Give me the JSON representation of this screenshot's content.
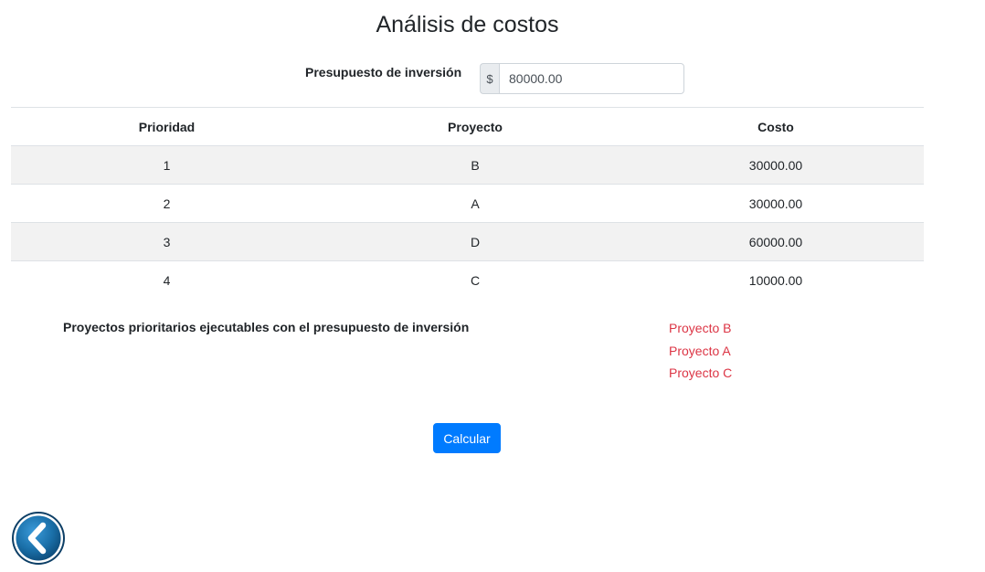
{
  "title": "Análisis de costos",
  "budget": {
    "label": "Presupuesto de inversión",
    "prefix": "$",
    "value": "80000.00"
  },
  "table": {
    "headers": {
      "priority": "Prioridad",
      "project": "Proyecto",
      "cost": "Costo"
    },
    "rows": [
      {
        "priority": "1",
        "project": "B",
        "cost": "30000.00"
      },
      {
        "priority": "2",
        "project": "A",
        "cost": "30000.00"
      },
      {
        "priority": "3",
        "project": "D",
        "cost": "60000.00"
      },
      {
        "priority": "4",
        "project": "C",
        "cost": "10000.00"
      }
    ]
  },
  "executable": {
    "label": "Proyectos prioritarios ejecutables con el presupuesto de inversión",
    "projects": [
      "Proyecto B",
      "Proyecto A",
      "Proyecto C"
    ]
  },
  "actions": {
    "calculate_label": "Calcular",
    "back_icon": "chevron-left-icon"
  },
  "colors": {
    "primary": "#007bff",
    "danger": "#dc3545",
    "back_button": "#1a6fa8"
  }
}
